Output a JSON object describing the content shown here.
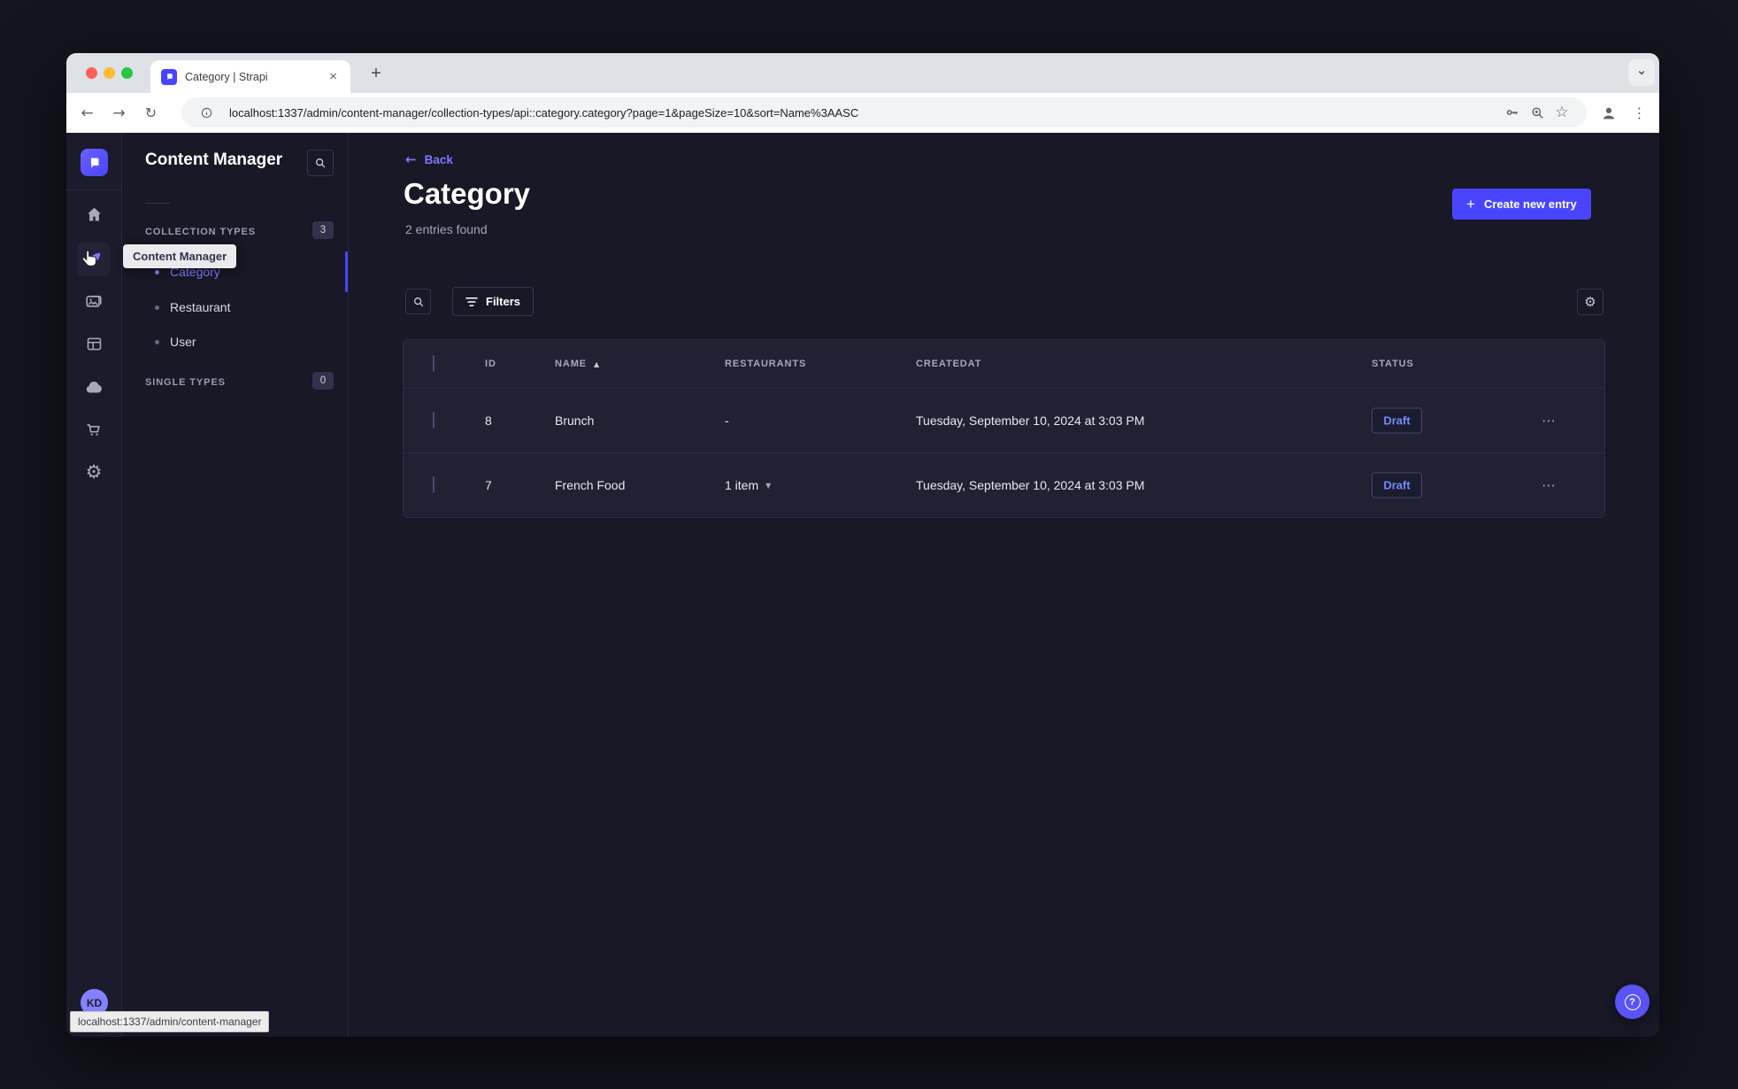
{
  "browser": {
    "tab_title": "Category | Strapi",
    "url": "localhost:1337/admin/content-manager/collection-types/api::category.category?page=1&pageSize=10&sort=Name%3AASC",
    "status_bubble": "localhost:1337/admin/content-manager"
  },
  "icons": {
    "back": "←",
    "forward": "→",
    "reload": "↻",
    "plus": "+",
    "close": "×",
    "star": "☆",
    "ellipsis_v": "⋮",
    "ellipsis_h": "⋯",
    "sort_asc": "▲",
    "caret_down": "▼",
    "gear": "⚙",
    "question": "?"
  },
  "nav_rail": {
    "user_initials": "KD"
  },
  "subnav": {
    "title": "Content Manager",
    "tooltip": "Content Manager",
    "sections": [
      {
        "label": "COLLECTION TYPES",
        "count": "3",
        "items": [
          {
            "label": "Category"
          },
          {
            "label": "Restaurant"
          },
          {
            "label": "User"
          }
        ]
      },
      {
        "label": "SINGLE TYPES",
        "count": "0",
        "items": []
      }
    ]
  },
  "main": {
    "back_label": "Back",
    "title": "Category",
    "subtitle": "2 entries found",
    "create_button": "Create new entry",
    "filters_button": "Filters",
    "table": {
      "columns": [
        "ID",
        "NAME",
        "RESTAURANTS",
        "CREATEDAT",
        "STATUS"
      ],
      "rows": [
        {
          "id": "8",
          "name": "Brunch",
          "restaurants": "-",
          "createdat": "Tuesday, September 10, 2024 at 3:03 PM",
          "status": "Draft"
        },
        {
          "id": "7",
          "name": "French Food",
          "restaurants": "1 item",
          "createdat": "Tuesday, September 10, 2024 at 3:03 PM",
          "status": "Draft"
        }
      ]
    }
  },
  "colors": {
    "primary": "#4945ff",
    "primary_light": "#7b79ff",
    "app_background": "#181826",
    "surface": "#212134",
    "draft_text": "#6f8cff",
    "chrome_tabstrip": "#dee1e6"
  }
}
